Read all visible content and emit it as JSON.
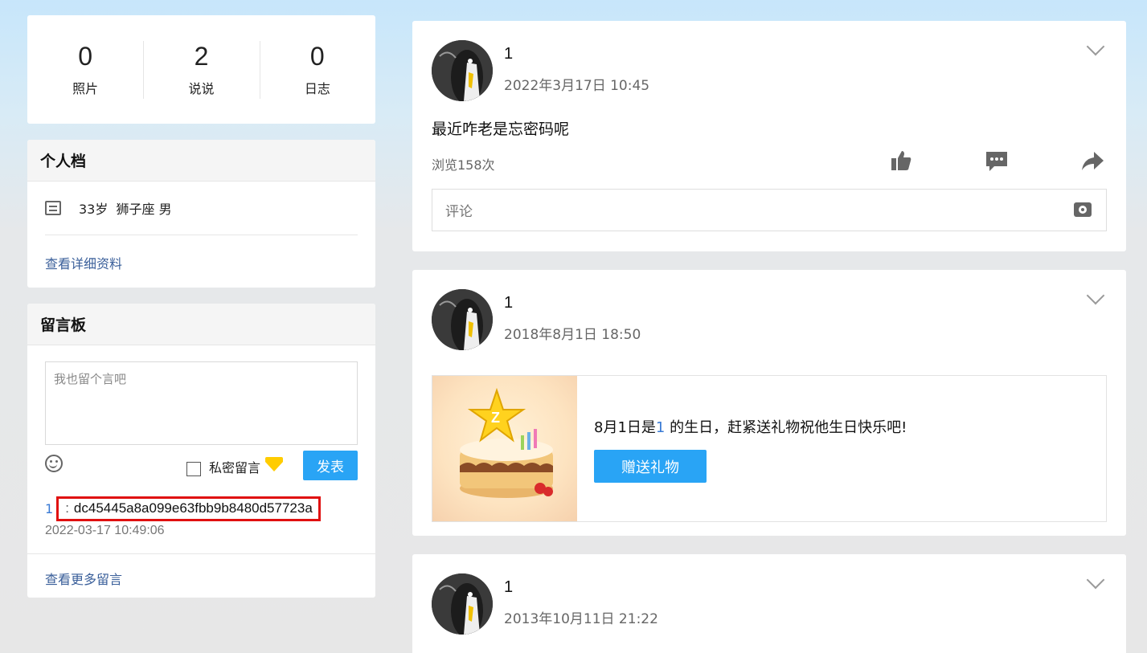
{
  "stats": [
    {
      "value": "0",
      "label": "照片"
    },
    {
      "value": "2",
      "label": "说说"
    },
    {
      "value": "0",
      "label": "日志"
    }
  ],
  "profile": {
    "title": "个人档",
    "info": "33岁  狮子座 男",
    "detail_link": "查看详细资料"
  },
  "board": {
    "title": "留言板",
    "placeholder": "我也留个言吧",
    "private_label": "私密留言",
    "post_button": "发表",
    "messages": [
      {
        "user": "1",
        "text": "dc45445a8a099e63fbb9b8480d57723a",
        "time": "2022-03-17 10:49:06"
      }
    ],
    "more_link": "查看更多留言"
  },
  "feed": [
    {
      "name": "1",
      "time": "2022年3月17日 10:45",
      "text": "最近咋老是忘密码呢",
      "views": "浏览158次",
      "comment_placeholder": "评论"
    },
    {
      "name": "1",
      "time": "2018年8月1日 18:50",
      "birthday": {
        "prefix": "8月1日是",
        "user": "1",
        "suffix": " 的生日，赶紧送礼物祝他生日快乐吧!",
        "button": "赠送礼物"
      }
    },
    {
      "name": "1",
      "time": "2013年10月11日 21:22"
    }
  ],
  "colors": {
    "accent": "#29a4f5",
    "link": "#3a5f9a",
    "highlight_border": "#e01010"
  },
  "icons": [
    "profile-card-icon",
    "smiley-icon",
    "diamond-icon",
    "chevron-down-icon",
    "like-icon",
    "comment-icon",
    "share-icon",
    "camera-icon"
  ]
}
